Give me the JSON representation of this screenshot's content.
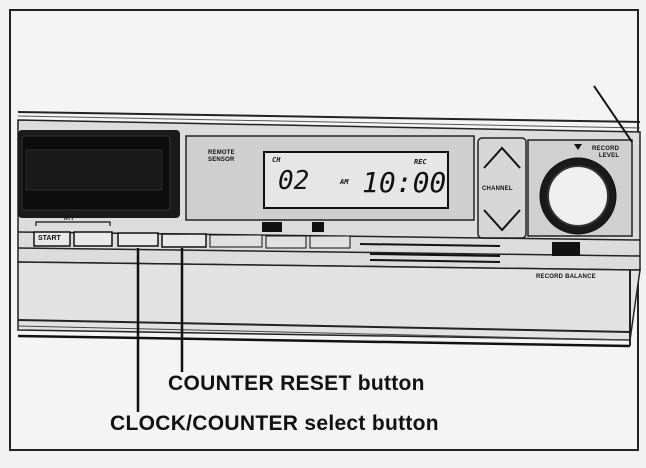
{
  "panel": {
    "remote_sensor_label": "REMOTE\nSENSOR",
    "channel_label": "CHANNEL",
    "record_level_label": "RECORD\nLEVEL",
    "record_balance_label": "RECORD BALANCE",
    "irt_label": "IRT",
    "start_label": "START",
    "display": {
      "ch_label": "CH",
      "channel_value": "02",
      "am_label": "AM",
      "rec_label": "REC",
      "time_value": "10:00"
    }
  },
  "callouts": {
    "counter_reset": "COUNTER RESET button",
    "clock_counter_select": "CLOCK/COUNTER select button"
  },
  "colors": {
    "ink": "#111111",
    "paper": "#f2f2f2"
  }
}
